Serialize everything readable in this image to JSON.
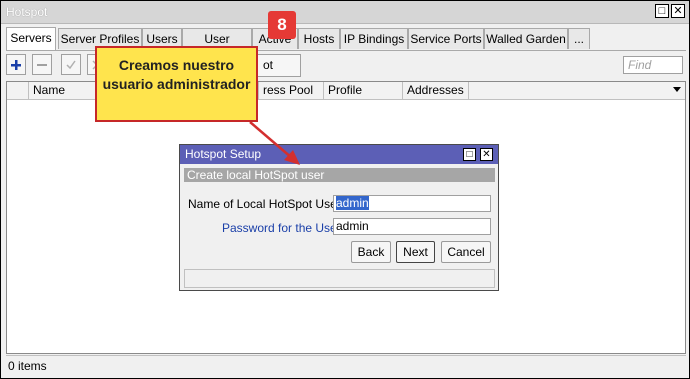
{
  "window": {
    "title": "Hotspot",
    "restore_icon": "restore-icon",
    "close_icon": "close-icon"
  },
  "tabs": [
    {
      "label": "Servers"
    },
    {
      "label": "Server Profiles"
    },
    {
      "label": "Users"
    },
    {
      "label": "User Profiles"
    },
    {
      "label": "Active"
    },
    {
      "label": "Hosts"
    },
    {
      "label": "IP Bindings"
    },
    {
      "label": "Service Ports"
    },
    {
      "label": "Walled Garden"
    },
    {
      "label": "..."
    }
  ],
  "toolbar": {
    "setup_label": "ot Setup",
    "find_placeholder": "Find"
  },
  "table": {
    "columns": [
      "Name",
      "ress Pool",
      "Profile",
      "Addresses ..."
    ]
  },
  "status": {
    "items": "0 items"
  },
  "dialog": {
    "title": "Hotspot Setup",
    "section": "Create local HotSpot user",
    "user_label": "Name of Local HotSpot User:",
    "user_value": "admin",
    "password_label": "Password for the User:",
    "password_value": "admin",
    "back_label": "Back",
    "next_label": "Next",
    "cancel_label": "Cancel"
  },
  "annotation": {
    "step": "8",
    "callout": "Creamos nuestro usuario administrador",
    "colors": {
      "badge": "#e53935",
      "callout_bg": "#ffe44d",
      "arrow": "#d32f2f"
    }
  }
}
